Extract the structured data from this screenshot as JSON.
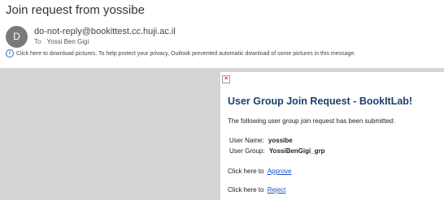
{
  "email": {
    "subject": "Join request from yossibe",
    "avatar_initial": "D",
    "sender": "do-not-reply@bookittest.cc.huji.ac.il",
    "to_label": "To",
    "to_value": "Yossi Ben Gigi",
    "info_icon": "info-icon",
    "info_bar_text": "Click here to download pictures. To help protect your privacy, Outlook prevented automatic download of some pictures in this message."
  },
  "message": {
    "broken_image_glyph": "×",
    "heading": "User Group Join Request - BookItLab!",
    "intro": "The following user group join request has been submitted:",
    "user_name_label": "User Name:",
    "user_name_value": "yossibe",
    "user_group_label": "User Group:",
    "user_group_value": "YossiBenGigi_grp",
    "click_here": "Click here to",
    "approve_link": "Approve",
    "reject_link": "Reject"
  },
  "colors": {
    "heading": "#1c3f6e",
    "link": "#1a4fc7",
    "body_background": "#d4d4d4"
  }
}
